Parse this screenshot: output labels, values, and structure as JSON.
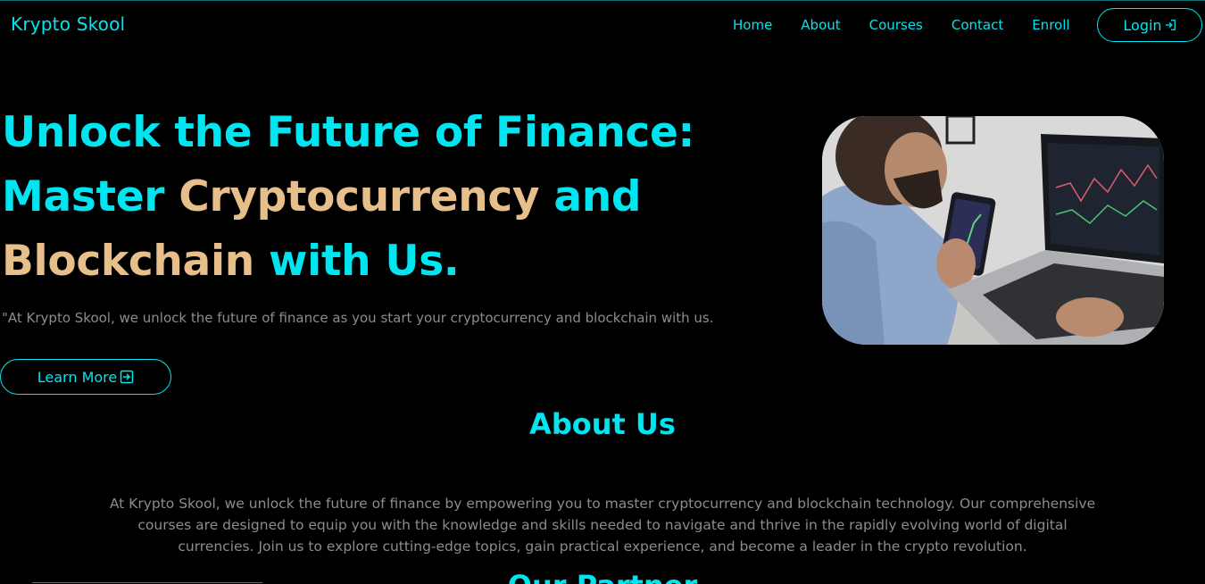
{
  "brand": "Krypto Skool",
  "nav": {
    "items": [
      "Home",
      "About",
      "Courses",
      "Contact",
      "Enroll"
    ],
    "login_label": "Login"
  },
  "hero": {
    "title_line1": "Unlock the Future of Finance:",
    "title_line2_a": "Master ",
    "title_line2_accent": "Cryptocurrency",
    "title_line2_b": " and",
    "title_line3_accent": "Blockchain",
    "title_line3_b": " with Us.",
    "subtitle": "\"At Krypto Skool, we unlock the future of finance as you start your cryptocurrency and blockchain with us.",
    "cta_label": "Learn More"
  },
  "about": {
    "title": "About Us",
    "text": "At Krypto Skool, we unlock the future of finance by empowering you to master cryptocurrency and blockchain technology. Our comprehensive courses are designed to equip you with the knowledge and skills needed to navigate and thrive in the rapidly evolving world of digital currencies. Join us to explore cutting-edge topics, gain practical experience, and become a leader in the crypto revolution."
  },
  "partner": {
    "title": "Our Partner"
  },
  "colors": {
    "accent": "#00e5f0",
    "highlight": "#e6bf8a",
    "background": "#000000",
    "muted_text": "#8c8c8c"
  },
  "icons": {
    "login": "enter-icon",
    "learn_more": "arrow-box-icon"
  }
}
